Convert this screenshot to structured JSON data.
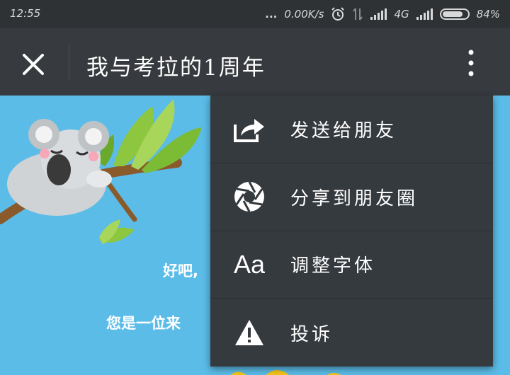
{
  "status_bar": {
    "time": "12:55",
    "dots": "...",
    "speed": "0.00K/s",
    "network": "4G",
    "battery_percent": "84%",
    "battery_level": 0.84
  },
  "app_bar": {
    "title": "我与考拉的1周年"
  },
  "content": {
    "text_line1": "好吧,",
    "text_line2": "您是一位来"
  },
  "menu": {
    "items": [
      {
        "label": "发送给朋友",
        "icon": "share-icon"
      },
      {
        "label": "分享到朋友圈",
        "icon": "moments-icon"
      },
      {
        "label": "调整字体",
        "icon": "font-icon",
        "icon_text": "Aa"
      },
      {
        "label": "投诉",
        "icon": "warning-icon"
      }
    ]
  },
  "colors": {
    "status_bar_bg": "#2f3235",
    "app_bar_bg": "#373a3e",
    "menu_bg": "#353a3f",
    "content_bg": "#5bbce8"
  }
}
